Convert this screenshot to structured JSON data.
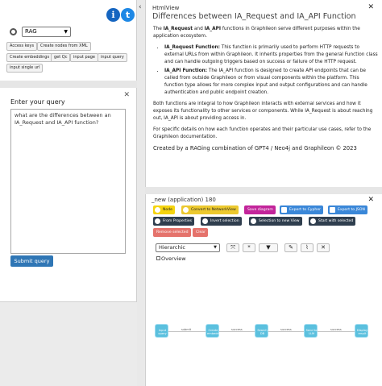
{
  "header": {
    "info_icon_label": "i",
    "t_icon_label": "t"
  },
  "left_panel": {
    "rag_select": "RAG",
    "buttons": [
      "Access keys",
      "Create nodes from XML",
      "Create embeddings",
      "get Qc",
      "input page",
      "input query",
      "input single url"
    ]
  },
  "query_panel": {
    "label": "Enter your query",
    "value": "what are the differences between an IA_Request and IA_API function?",
    "submit": "Submit query"
  },
  "html_view": {
    "small_title": "HtmlView",
    "title": "Differences between IA_Request and IA_API Function",
    "intro_pre": "The ",
    "intro_b1": "IA_Request",
    "intro_mid": " and ",
    "intro_b2": "IA_API",
    "intro_post": " functions in Graphileon serve different purposes within the application ecosystem.",
    "li1_b": "IA_Request Function:",
    "li1_text": " This function is primarily used to perform HTTP requests to external URLs from within Graphileon. It inherits properties from the general Function class and can handle outgoing triggers based on success or failure of the HTTP request.",
    "li2_b": "IA_API Function:",
    "li2_text": " The IA_API function is designed to create API endpoints that can be called from outside Graphileon or from visual components within the platform. This function type allows for more complex input and output configurations and can handle authentication and public endpoint creation.",
    "para2": "Both functions are integral to how Graphileon interacts with external services and how it exposes its functionality to other services or components. While IA_Request is about reaching out, IA_API is about providing access in.",
    "para3": "For specific details on how each function operates and their particular use cases, refer to the Graphileon documentation.",
    "credit": "Created by a RAGing combination of GPT4 / Neo4j and Graphileon © 2023"
  },
  "app_panel": {
    "title": "_new (application) 180",
    "toolbar": {
      "node": "Node",
      "convert": "Convert to NetworkView",
      "save": "Save diagram",
      "export_cypher": "Export to Cypher",
      "export_json": "Export to JSON",
      "from_props": "From Properties",
      "invert": "Invert selection",
      "sel_new_view": "Selection to new View",
      "start_sel": "Start with selected",
      "remove_sel": "Remove selected",
      "clear": "Clear"
    },
    "layout_select": "Hierarchic",
    "overview": "Overview",
    "flow": {
      "nodes": [
        "Input query",
        "Create embedding",
        "Search DB",
        "Send to LLM",
        "Display result"
      ],
      "edges": [
        "submit",
        "success",
        "success",
        "success"
      ]
    }
  },
  "colors": {
    "accent": "#2f76b5",
    "node_yellow": "#f5d40f",
    "convert_yellow": "#ecc92f",
    "save_magenta": "#c2249a",
    "export_blue": "#3a87d8",
    "dark": "#2f3e4e",
    "remove_red": "#e5736c",
    "flow_node": "#5bc0de"
  }
}
